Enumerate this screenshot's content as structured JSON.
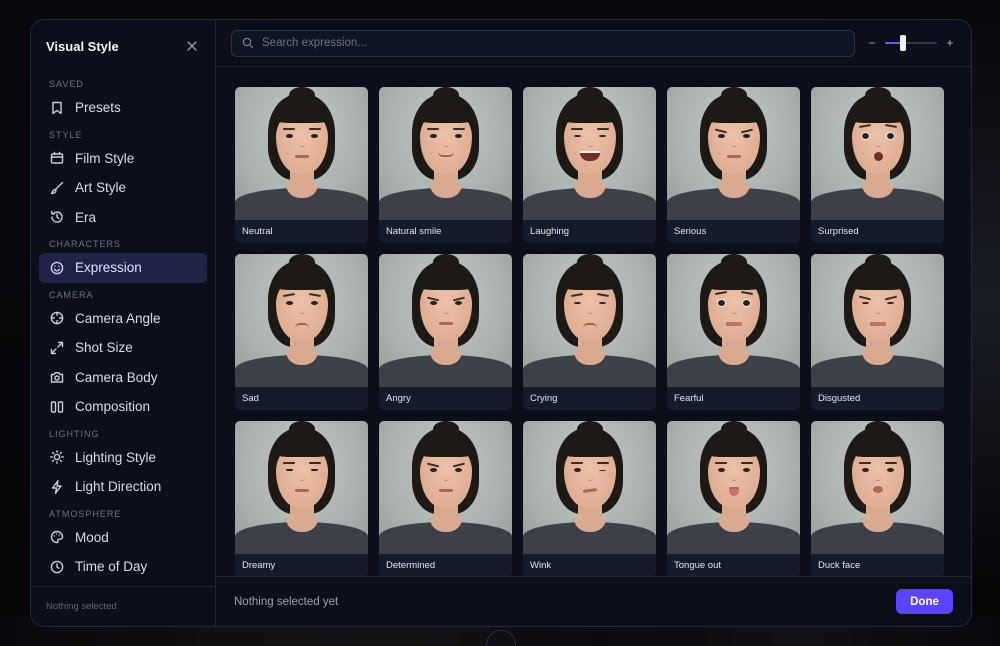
{
  "sidebar": {
    "title": "Visual Style",
    "sections": [
      {
        "label": "SAVED",
        "items": [
          {
            "label": "Presets",
            "icon": "bookmark-icon"
          }
        ]
      },
      {
        "label": "STYLE",
        "items": [
          {
            "label": "Film Style",
            "icon": "film-icon"
          },
          {
            "label": "Art Style",
            "icon": "brush-icon"
          },
          {
            "label": "Era",
            "icon": "history-icon"
          }
        ]
      },
      {
        "label": "CHARACTERS",
        "items": [
          {
            "label": "Expression",
            "icon": "smile-icon",
            "active": true
          }
        ]
      },
      {
        "label": "CAMERA",
        "items": [
          {
            "label": "Camera Angle",
            "icon": "crosshair-icon"
          },
          {
            "label": "Shot Size",
            "icon": "expand-icon"
          },
          {
            "label": "Camera Body",
            "icon": "camera-icon"
          },
          {
            "label": "Composition",
            "icon": "columns-icon"
          }
        ]
      },
      {
        "label": "LIGHTING",
        "items": [
          {
            "label": "Lighting Style",
            "icon": "sun-icon"
          },
          {
            "label": "Light Direction",
            "icon": "bolt-icon"
          }
        ]
      },
      {
        "label": "ATMOSPHERE",
        "items": [
          {
            "label": "Mood",
            "icon": "palette-icon"
          },
          {
            "label": "Time of Day",
            "icon": "clock-icon"
          }
        ]
      }
    ],
    "footer": "Nothing selected"
  },
  "search": {
    "placeholder": "Search expression...",
    "value": ""
  },
  "zoom": {
    "minus": "−",
    "plus": "+",
    "level": 0.35
  },
  "expressions": [
    {
      "label": "Neutral",
      "brow": 0,
      "mouth": "flat",
      "eyes": "open"
    },
    {
      "label": "Natural smile",
      "brow": 0,
      "mouth": "smile",
      "eyes": "open"
    },
    {
      "label": "Laughing",
      "brow": 0,
      "mouth": "laugh",
      "eyes": "squint"
    },
    {
      "label": "Serious",
      "brow": -1,
      "mouth": "flat",
      "eyes": "open"
    },
    {
      "label": "Surprised",
      "brow": 2,
      "mouth": "o",
      "eyes": "wide"
    },
    {
      "label": "Sad",
      "brow": 1,
      "mouth": "frown",
      "eyes": "open"
    },
    {
      "label": "Angry",
      "brow": -2,
      "mouth": "flat",
      "eyes": "open"
    },
    {
      "label": "Crying",
      "brow": 1,
      "mouth": "frown",
      "eyes": "squint"
    },
    {
      "label": "Fearful",
      "brow": 2,
      "mouth": "grimace",
      "eyes": "wide"
    },
    {
      "label": "Disgusted",
      "brow": -1,
      "mouth": "grimace",
      "eyes": "squint"
    },
    {
      "label": "Dreamy",
      "brow": 0,
      "mouth": "flat",
      "eyes": "half"
    },
    {
      "label": "Determined",
      "brow": -1,
      "mouth": "flat",
      "eyes": "open"
    },
    {
      "label": "Wink",
      "brow": 0,
      "mouth": "smirk",
      "eyes": "wink"
    },
    {
      "label": "Tongue out",
      "brow": 0,
      "mouth": "tongue",
      "eyes": "open"
    },
    {
      "label": "Duck face",
      "brow": 0,
      "mouth": "duck",
      "eyes": "open"
    }
  ],
  "bottom": {
    "status": "Nothing selected yet",
    "done_label": "Done"
  },
  "colors": {
    "accent": "#5a45ff",
    "active_bg": "#1f2347",
    "panel_bg": "#0b0f1a"
  }
}
